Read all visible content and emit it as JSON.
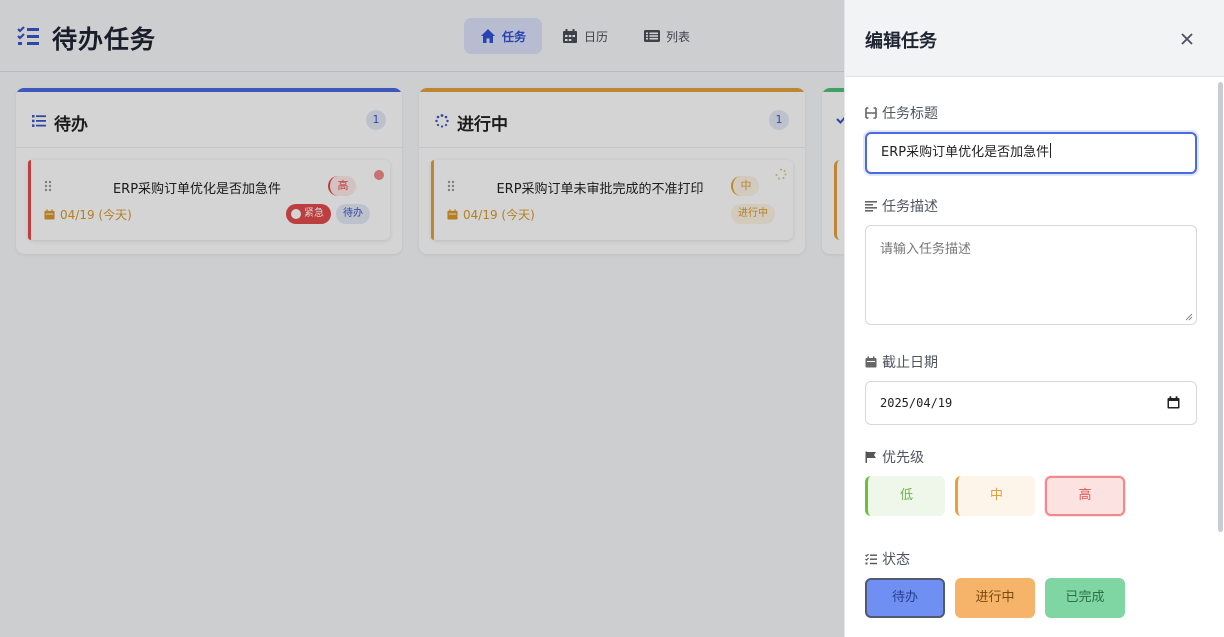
{
  "app": {
    "title": "待办任务",
    "tabs": [
      {
        "label": "任务",
        "icon": "home-icon",
        "active": true
      },
      {
        "label": "日历",
        "icon": "calendar-icon",
        "active": false
      },
      {
        "label": "列表",
        "icon": "list-icon",
        "active": false
      }
    ]
  },
  "columns": [
    {
      "title": "待办",
      "icon": "list-check-icon",
      "count": "1",
      "accent": "#4a6ae0",
      "card": {
        "title": "ERP采购订单优化是否加急件",
        "priority": "高",
        "date": "04/19 (今天)",
        "urgent": "紧急",
        "status": "待办"
      }
    },
    {
      "title": "进行中",
      "icon": "spinner-icon",
      "count": "1",
      "accent": "#e6a23c",
      "card": {
        "title": "ERP采购订单未审批完成的不准打印",
        "priority": "中",
        "date": "04/19 (今天)",
        "status": "进行中"
      }
    },
    {
      "title": "",
      "icon": "check-icon",
      "accent": "#4cc27a"
    }
  ],
  "panel": {
    "title": "编辑任务",
    "fields": {
      "title_label": "任务标题",
      "title_value": "ERP采购订单优化是否加急件",
      "desc_label": "任务描述",
      "desc_placeholder": "请输入任务描述",
      "date_label": "截止日期",
      "date_value": "2025/04/19",
      "priority_label": "优先级",
      "priority_options": [
        "低",
        "中",
        "高"
      ],
      "priority_selected": "高",
      "status_label": "状态",
      "status_options": [
        "待办",
        "进行中",
        "已完成"
      ],
      "status_selected": "待办"
    }
  },
  "colors": {
    "primary": "#4a6ae0",
    "danger": "#e34b4b",
    "warning": "#e6a23c",
    "success": "#67c23a"
  }
}
